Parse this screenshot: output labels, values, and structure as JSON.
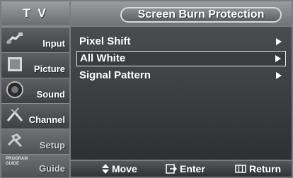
{
  "sidebar": {
    "title": "T V",
    "items": [
      {
        "label": "Input",
        "icon": "input-cable-icon"
      },
      {
        "label": "Picture",
        "icon": "picture-icon"
      },
      {
        "label": "Sound",
        "icon": "speaker-icon"
      },
      {
        "label": "Channel",
        "icon": "antenna-icon"
      },
      {
        "label": "Setup",
        "icon": "setup-icon"
      },
      {
        "label": "Guide",
        "icon": "guide-icon"
      }
    ],
    "guide_icon_text": "PROGRAM GUIDE"
  },
  "header": {
    "title": "Screen Burn Protection"
  },
  "menu": {
    "items": [
      {
        "label": "Pixel Shift",
        "selected": false
      },
      {
        "label": "All White",
        "selected": true
      },
      {
        "label": "Signal Pattern",
        "selected": false
      }
    ]
  },
  "footer": {
    "move_label": "Move",
    "enter_label": "Enter",
    "return_label": "Return"
  },
  "colors": {
    "background": "#6f7073",
    "menu_bg": "#3a3c40",
    "text": "#ffffff"
  }
}
